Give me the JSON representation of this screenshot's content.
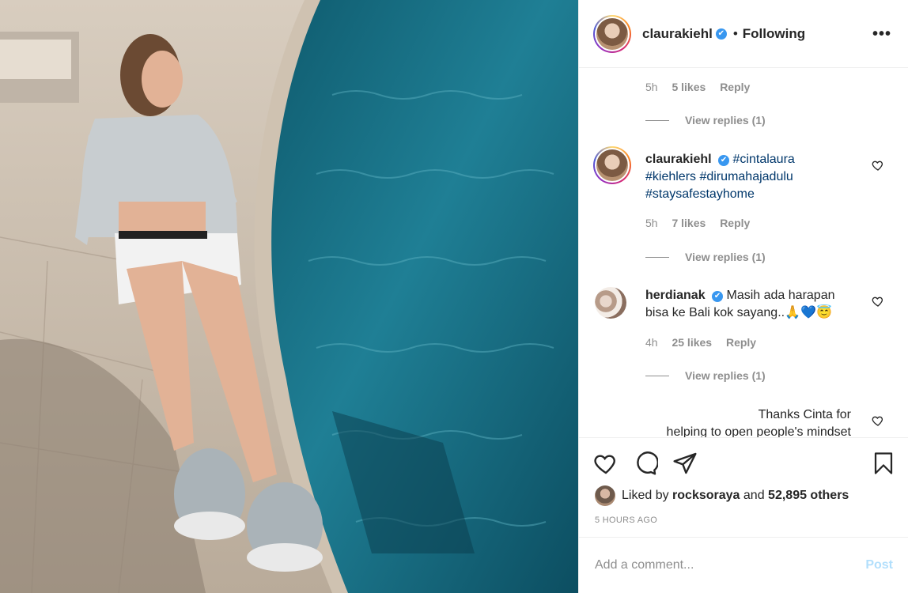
{
  "post": {
    "image_alt": "Woman sitting by a swimming pool"
  },
  "header": {
    "username": "claurakiehl",
    "verified_mark": "✔",
    "dot": "•",
    "following_label": "Following",
    "more_label": "•••"
  },
  "comments": [
    {
      "time": "5h",
      "likes": "5 likes",
      "reply": "Reply",
      "view_replies": "View replies (1)"
    },
    {
      "username": "claurakiehl",
      "tags": [
        "#cintalaura",
        "#kiehlers",
        "#dirumahajadulu",
        "#staysafestayhome"
      ],
      "time": "5h",
      "likes": "7 likes",
      "reply": "Reply",
      "view_replies": "View replies (1)"
    },
    {
      "username": "herdianak",
      "text_line1": "Masih ada harapan",
      "text_line2": "bisa ke Bali kok sayang..🙏💙😇",
      "time": "4h",
      "likes": "25 likes",
      "reply": "Reply",
      "view_replies": "View replies (1)"
    },
    {
      "text_line1": "Thanks Cinta for",
      "text_line2": "helping to open people's mindset"
    }
  ],
  "actions": {
    "liked_prefix": "Liked by",
    "liked_user": "rocksoraya",
    "liked_and": "and",
    "liked_others": "52,895 others",
    "time_ago": "5 HOURS AGO",
    "comment_placeholder": "Add a comment...",
    "post_label": "Post"
  },
  "colors": {
    "link": "#00376b",
    "verified": "#3897f0",
    "muted": "#8e8e8e",
    "post_disabled": "#b2dffc"
  }
}
